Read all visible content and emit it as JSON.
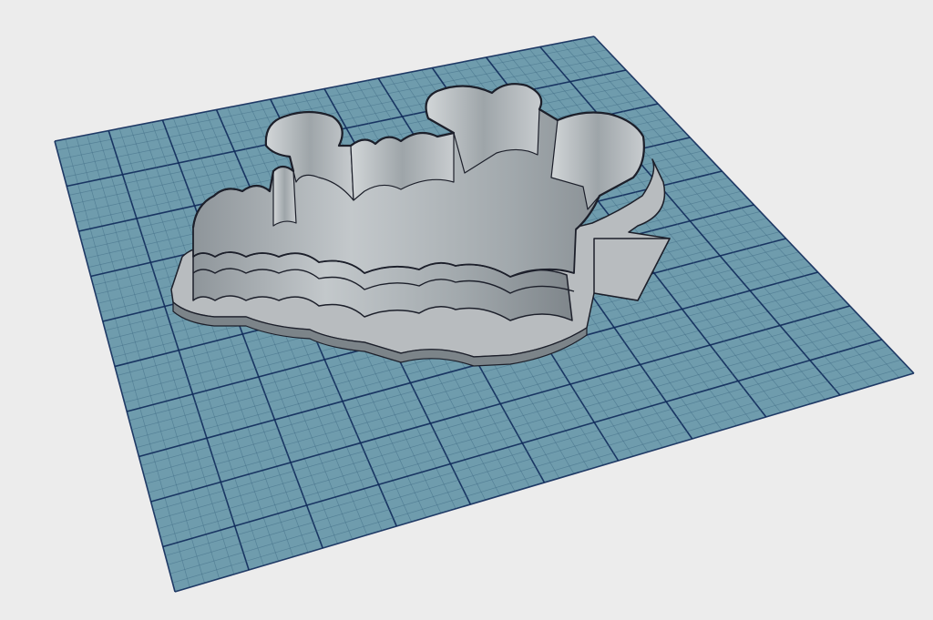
{
  "viewport": {
    "view": "perspective",
    "background_color": "#ececec",
    "grid": {
      "visible": true,
      "fill_color": "#6f9cad",
      "major_line_color": "#102a5a",
      "minor_line_color": "#3f6c85",
      "major_divisions": 10,
      "minor_subdivisions": 5
    },
    "model": {
      "name": "cookie-cutter",
      "wall_color": "#a7adb1",
      "wall_shadow_color": "#7c8489",
      "flange_color": "#b8bcbf",
      "edge_color": "#1c1f2a"
    }
  }
}
